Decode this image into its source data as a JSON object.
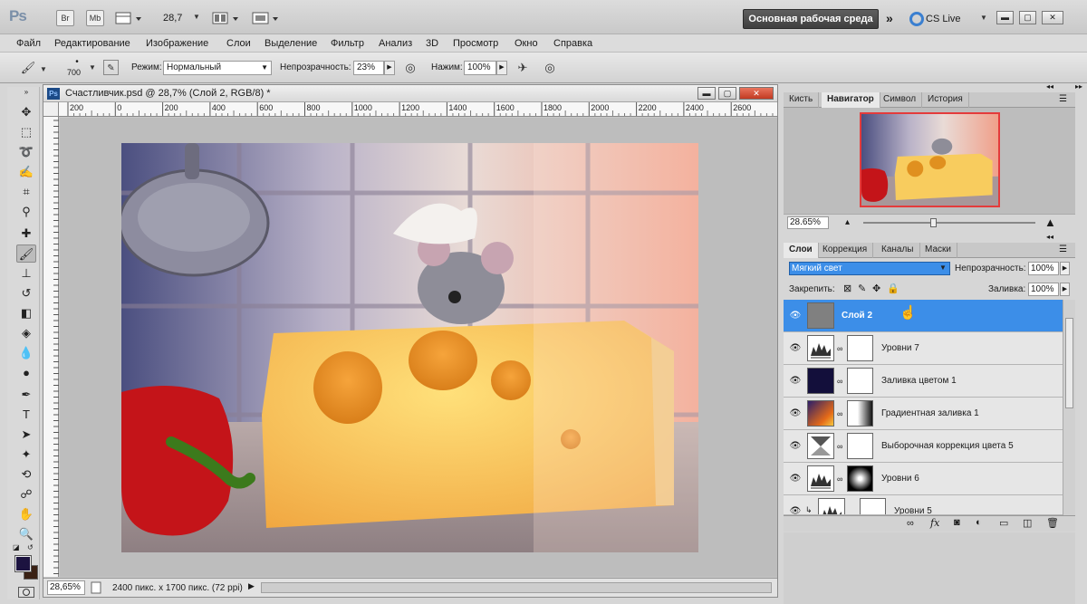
{
  "app": {
    "logo": "Ps",
    "bridge_btn": "Br",
    "minibridge_btn": "Mb",
    "zoom": "28,7",
    "workspace": "Основная рабочая среда",
    "cs_live": "CS Live"
  },
  "menu": [
    "Файл",
    "Редактирование",
    "Изображение",
    "Слои",
    "Выделение",
    "Фильтр",
    "Анализ",
    "3D",
    "Просмотр",
    "Окно",
    "Справка"
  ],
  "options": {
    "brush_size": "700",
    "mode_label": "Режим:",
    "mode_value": "Нормальный",
    "opacity_label": "Непрозрачность:",
    "opacity_value": "23%",
    "flow_label": "Нажим:",
    "flow_value": "100%"
  },
  "document": {
    "title": "Счастливчик.psd @ 28,7% (Слой 2, RGB/8) *",
    "ruler_marks": [
      "200",
      "0",
      "200",
      "400",
      "600",
      "800",
      "1000",
      "1200",
      "1400",
      "1600",
      "1800",
      "2000",
      "2200",
      "2400",
      "2600"
    ],
    "zoom_status": "28,65%",
    "size_status": "2400 пикс. x 1700 пикс. (72 ppi)"
  },
  "navigator": {
    "tabs": [
      "Кисть",
      "Навигатор",
      "Символ",
      "История"
    ],
    "active_tab": "Навигатор",
    "zoom": "28.65%"
  },
  "layers_panel": {
    "tabs": [
      "Слои",
      "Коррекция",
      "Каналы",
      "Маски"
    ],
    "blend_mode": "Мягкий свет",
    "opacity_label": "Непрозрачность:",
    "opacity_value": "100%",
    "lock_label": "Закрепить:",
    "fill_label": "Заливка:",
    "fill_value": "100%",
    "layers": [
      {
        "name": "Слой 2",
        "selected": true,
        "type": "pixel"
      },
      {
        "name": "Уровни 7",
        "selected": false,
        "type": "levels"
      },
      {
        "name": "Заливка цветом 1",
        "selected": false,
        "type": "solid"
      },
      {
        "name": "Градиентная заливка 1",
        "selected": false,
        "type": "gradient"
      },
      {
        "name": "Выборочная коррекция цвета 5",
        "selected": false,
        "type": "selective"
      },
      {
        "name": "Уровни 6",
        "selected": false,
        "type": "levels"
      },
      {
        "name": "Уровни 5",
        "selected": false,
        "type": "levels"
      }
    ]
  },
  "colors": {
    "foreground": "#1c1340",
    "background": "#3a2114",
    "selection": "#3c8ee8",
    "nav_frame": "#e43b3b"
  }
}
